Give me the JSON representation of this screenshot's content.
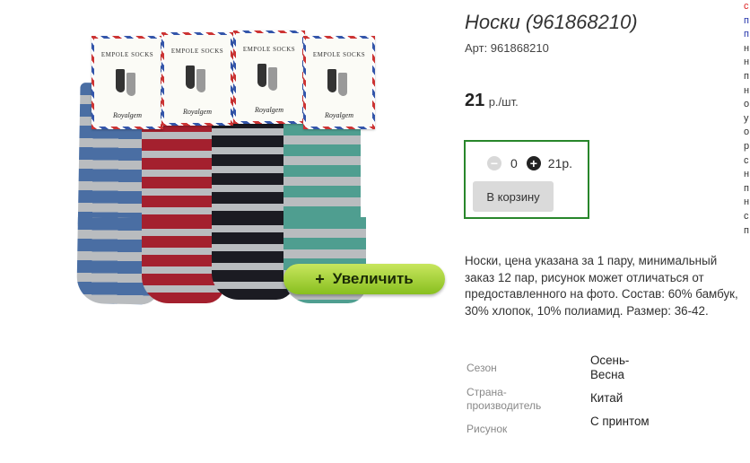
{
  "product": {
    "title": "Носки (961868210)",
    "article": "Арт: 961868210",
    "price_value": "21",
    "price_unit": "р./шт.",
    "description": "Носки, цена указана за 1 пару, минимальный заказ 12 пар, рисунок может отличаться от предоставленного на фото. Состав: 60% бамбук, 30% хлопок, 10% полиамид. Размер: 36-42."
  },
  "image": {
    "zoom_label": "Увеличить",
    "zoom_icon": "+",
    "card_brand": "EMPOLE SOCKS",
    "card_sign": "Royalgem",
    "sock_colors": [
      "#4a6ea3",
      "#a4202e",
      "#1b1b22",
      "#4f9e90"
    ],
    "stripe_color": "#b9bcbf"
  },
  "cart": {
    "minus_icon": "−",
    "plus_icon": "+",
    "quantity": "0",
    "sum": "21р.",
    "button_label": "В корзину"
  },
  "attributes": [
    {
      "key": "Сезон",
      "value": "Осень-Весна"
    },
    {
      "key": "Страна-производитель",
      "value": "Китай"
    },
    {
      "key": "Рисунок",
      "value": "С принтом"
    }
  ],
  "side_strip": [
    "с",
    "п",
    "п",
    "н",
    "н",
    "п",
    "н",
    "о",
    "у",
    "о",
    "р",
    "с",
    "н",
    "п",
    "н",
    "с",
    "п"
  ]
}
